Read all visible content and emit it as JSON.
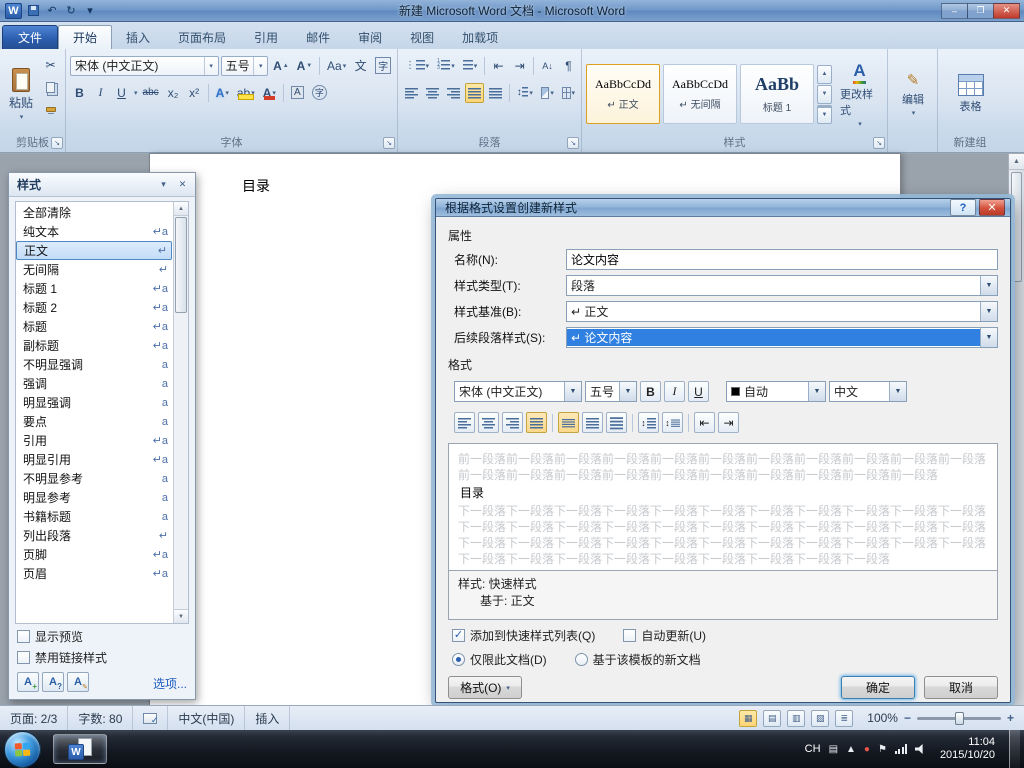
{
  "window": {
    "title": "新建 Microsoft Word 文档 - Microsoft Word"
  },
  "icons": {
    "word": "W",
    "dropdown": "▾",
    "undo": "↶",
    "redo": "↻",
    "minimize": "–",
    "maximize": "❐",
    "close": "✕",
    "help": "?",
    "launcher": "↘",
    "cut": "✂",
    "pilcrow": "¶",
    "up": "▲",
    "down": "▼",
    "bold": "B",
    "italic": "I",
    "underline": "U",
    "strike": "abc",
    "subscript": "x₂",
    "superscript": "x²",
    "grow_font": "A",
    "shrink_font": "A",
    "change_case": "Aa",
    "phonetic": "文",
    "char_border": "字",
    "text_effects": "A",
    "highlight": "ab",
    "font_color": "A",
    "char_shading": "A",
    "enclose": "字",
    "numbers": "1\n2\n3",
    "sort": "A↓",
    "line_spacing": "↕",
    "outdent": "⇤",
    "indent": "⇥",
    "edit_pencil": "✎",
    "view1": "▦",
    "view2": "▤",
    "view3": "▥",
    "view4": "▧",
    "view5": "≣",
    "caret_up": "▲",
    "flag": "⚑",
    "keyboard": "▤",
    "dot": "●"
  },
  "ribbon": {
    "file_tab": "文件",
    "tabs": [
      {
        "label": "开始",
        "active": true
      },
      {
        "label": "插入"
      },
      {
        "label": "页面布局"
      },
      {
        "label": "引用"
      },
      {
        "label": "邮件"
      },
      {
        "label": "审阅"
      },
      {
        "label": "视图"
      },
      {
        "label": "加载项"
      }
    ],
    "clipboard": {
      "paste": "粘贴",
      "group": "剪贴板"
    },
    "font": {
      "name": "宋体 (中文正文)",
      "size": "五号",
      "group": "字体"
    },
    "paragraph": {
      "group": "段落"
    },
    "styles": {
      "group": "样式",
      "gallery": [
        {
          "sample": "AaBbCcDd",
          "name": "↵ 正文",
          "selected": true
        },
        {
          "sample": "AaBbCcDd",
          "name": "↵ 无间隔"
        },
        {
          "sample": "AaBb",
          "name": "标题 1",
          "heading": true
        }
      ],
      "change_styles": "更改样式"
    },
    "editing": {
      "label": "编辑"
    },
    "newgroup": {
      "table": "表格",
      "group": "新建组"
    }
  },
  "document": {
    "heading": "目录"
  },
  "styles_pane": {
    "title": "样式",
    "items": [
      {
        "label": "全部清除",
        "marker": "none"
      },
      {
        "label": "纯文本",
        "marker": "both"
      },
      {
        "label": "正文",
        "marker": "para",
        "selected": true
      },
      {
        "label": "无间隔",
        "marker": "para"
      },
      {
        "label": "标题 1",
        "marker": "both"
      },
      {
        "label": "标题 2",
        "marker": "both"
      },
      {
        "label": "标题",
        "marker": "both"
      },
      {
        "label": "副标题",
        "marker": "both"
      },
      {
        "label": "不明显强调",
        "marker": "char"
      },
      {
        "label": "强调",
        "marker": "char"
      },
      {
        "label": "明显强调",
        "marker": "char"
      },
      {
        "label": "要点",
        "marker": "char"
      },
      {
        "label": "引用",
        "marker": "both"
      },
      {
        "label": "明显引用",
        "marker": "both"
      },
      {
        "label": "不明显参考",
        "marker": "char"
      },
      {
        "label": "明显参考",
        "marker": "char"
      },
      {
        "label": "书籍标题",
        "marker": "char"
      },
      {
        "label": "列出段落",
        "marker": "para"
      },
      {
        "label": "页脚",
        "marker": "both"
      },
      {
        "label": "页眉",
        "marker": "both"
      }
    ],
    "show_preview": "显示预览",
    "disable_linked": "禁用链接样式",
    "options": "选项..."
  },
  "dialog": {
    "title": "根据格式设置创建新样式",
    "properties_label": "属性",
    "fields": [
      {
        "label": "名称(N):",
        "value": "论文内容"
      },
      {
        "label": "样式类型(T):",
        "value": "段落"
      },
      {
        "label": "样式基准(B):",
        "value": "↵ 正文"
      },
      {
        "label": "后续段落样式(S):",
        "value": "↵ 论文内容"
      }
    ],
    "format_label": "格式",
    "font_name": "宋体 (中文正文)",
    "font_size": "五号",
    "color": "自动",
    "language": "中文",
    "preview": {
      "before_unit": "前一段落",
      "before_count": 21,
      "current": "目录",
      "after_unit": "下一段落",
      "after_count": 42
    },
    "style_desc_1": "样式: 快速样式",
    "style_desc_2": "基于: 正文",
    "add_to_list": "添加到快速样式列表(Q)",
    "auto_update": "自动更新(U)",
    "only_doc": "仅限此文档(D)",
    "new_docs": "基于该模板的新文档",
    "format_button": "格式(O)",
    "ok": "确定",
    "cancel": "取消"
  },
  "status_bar": {
    "page": "页面: 2/3",
    "words": "字数: 80",
    "language": "中文(中国)",
    "insert": "插入",
    "zoom": "100%",
    "minus": "−",
    "plus": "+"
  },
  "taskbar": {
    "input": "CH",
    "time": "11:04",
    "date": "2015/10/20"
  }
}
